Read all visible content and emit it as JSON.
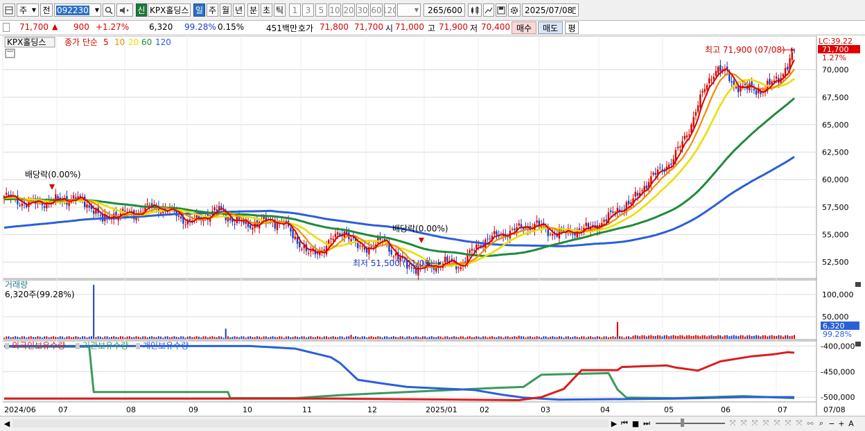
{
  "toolbar": {
    "period": "주",
    "prev": "전",
    "code": "092230",
    "new_badge": "신",
    "stock_name": "KPX홀딩스",
    "tf_day": "일",
    "tf_week": "주",
    "tf_month": "월",
    "tf_year": "년",
    "tf_min": "분",
    "tf_sec": "초",
    "tf_tick": "틱",
    "n1": "1",
    "n3": "3",
    "n5": "5",
    "n10": "10",
    "n20": "20",
    "n30": "30",
    "n60": "60",
    "n120": "120",
    "count": "265",
    "count_total": "/600",
    "date": "2025/07/08"
  },
  "info": {
    "price": "71,700",
    "change_arrow": "▲",
    "change": "900",
    "change_pct": "+1.27%",
    "volume": "6,320",
    "vol_ratio": "99.28%",
    "turnover": "0.15%",
    "amount": "451백만",
    "bid_label": "호가",
    "bid1": "71,800",
    "bid2": "71,700",
    "open_label": "시",
    "open": "71,000",
    "high_label": "고",
    "high": "71,900",
    "low_label": "저",
    "low": "70,400",
    "buy": "매수",
    "sell": "매도",
    "eval": "평"
  },
  "legend": {
    "name": "KPX홀딩스",
    "type": "종가 단순",
    "ma5": "5",
    "ma10": "10",
    "ma20": "20",
    "ma60": "60",
    "ma120": "120"
  },
  "colors": {
    "up": "#d60000",
    "down": "#1a3dbf",
    "ma5": "#d60000",
    "ma10": "#f08c00",
    "ma20": "#e8e000",
    "ma60": "#1e8a3c",
    "ma120": "#2a5fd8",
    "foreign": "#d81e1e",
    "inst": "#3a9a5a",
    "indiv": "#2a5fd8"
  },
  "chart_data": [
    {
      "type": "candlestick",
      "title": "KPX홀딩스",
      "ylim": [
        51000,
        73000
      ],
      "y_ticks": [
        "52,500",
        "55,000",
        "57,500",
        "60,000",
        "62,500",
        "65,000",
        "67,500",
        "70,000"
      ],
      "x_ticks": [
        "2024/06",
        "07",
        "08",
        "09",
        "10",
        "11",
        "12",
        "2025/01",
        "02",
        "03",
        "04",
        "05",
        "06",
        "07",
        "07/08"
      ],
      "close_anchors": [
        [
          0,
          58500
        ],
        [
          10,
          57800
        ],
        [
          20,
          58000
        ],
        [
          32,
          58300
        ],
        [
          40,
          57400
        ],
        [
          44,
          56200
        ],
        [
          48,
          56800
        ],
        [
          58,
          56900
        ],
        [
          66,
          57600
        ],
        [
          76,
          57000
        ],
        [
          82,
          56100
        ],
        [
          88,
          56500
        ],
        [
          96,
          57300
        ],
        [
          102,
          56300
        ],
        [
          110,
          55900
        ],
        [
          118,
          56300
        ],
        [
          125,
          56000
        ],
        [
          130,
          54700
        ],
        [
          136,
          53200
        ],
        [
          142,
          53600
        ],
        [
          148,
          54800
        ],
        [
          152,
          55400
        ],
        [
          158,
          53800
        ],
        [
          164,
          53900
        ],
        [
          170,
          54500
        ],
        [
          174,
          53200
        ],
        [
          180,
          52200
        ],
        [
          186,
          51900
        ],
        [
          192,
          52200
        ],
        [
          198,
          52500
        ],
        [
          204,
          52200
        ],
        [
          208,
          53200
        ],
        [
          212,
          54100
        ],
        [
          216,
          54600
        ],
        [
          222,
          55000
        ],
        [
          228,
          55400
        ],
        [
          232,
          55700
        ],
        [
          238,
          55900
        ],
        [
          244,
          55200
        ],
        [
          250,
          55100
        ],
        [
          254,
          55300
        ],
        [
          258,
          55400
        ],
        [
          262,
          55600
        ],
        [
          268,
          56200
        ],
        [
          274,
          57300
        ],
        [
          280,
          57800
        ],
        [
          284,
          59000
        ],
        [
          290,
          60300
        ],
        [
          294,
          61000
        ],
        [
          298,
          61600
        ],
        [
          302,
          63000
        ],
        [
          306,
          64600
        ],
        [
          310,
          66800
        ],
        [
          314,
          68700
        ],
        [
          318,
          70100
        ],
        [
          322,
          69800
        ],
        [
          326,
          68600
        ],
        [
          332,
          68300
        ],
        [
          338,
          68100
        ],
        [
          342,
          68600
        ],
        [
          346,
          69200
        ],
        [
          350,
          70400
        ],
        [
          353,
          71700
        ]
      ],
      "last_close": 71700,
      "annotations": {
        "max": "최고 71,900 (07/08)",
        "min": "최저 51,500 (01/09)",
        "dividend1": "배당락(0.00%)",
        "dividend2": "배당락(0.00%)"
      },
      "right_axis": {
        "lc_label": "LC:39.22",
        "price": "71,700",
        "pct": "1.27%"
      }
    },
    {
      "type": "bar",
      "title": "거래량",
      "current": "6,320주(99.28%)",
      "ylim": [
        0,
        125000
      ],
      "y_ticks": [
        "50,000",
        "100,000"
      ],
      "spikes": [
        {
          "i": 40,
          "v": 122000
        },
        {
          "i": 99,
          "v": 23000
        },
        {
          "i": 274,
          "v": 38000
        },
        {
          "i": 155,
          "v": 9000
        },
        {
          "i": 230,
          "v": 7000
        }
      ],
      "last_value": "6,320",
      "last_pct": "99.28%"
    },
    {
      "type": "line",
      "series_labels": [
        "외국인보유수량",
        "기관보유수량",
        "개인보유수량"
      ],
      "ylim": [
        -508000,
        -394000
      ],
      "y_ticks": [
        "-400,000",
        "-450,000",
        "-500,000"
      ],
      "foreign": [
        [
          0,
          -503000
        ],
        [
          150,
          -503000
        ],
        [
          230,
          -506000
        ],
        [
          240,
          -500000
        ],
        [
          250,
          -484000
        ],
        [
          258,
          -447000
        ],
        [
          274,
          -447000
        ],
        [
          276,
          -441000
        ],
        [
          296,
          -438000
        ],
        [
          300,
          -442000
        ],
        [
          310,
          -448000
        ],
        [
          320,
          -430000
        ],
        [
          334,
          -420000
        ],
        [
          344,
          -416000
        ],
        [
          350,
          -412000
        ],
        [
          353,
          -413000
        ]
      ],
      "institution": [
        [
          0,
          -401000
        ],
        [
          38,
          -401000
        ],
        [
          40,
          -490000
        ],
        [
          100,
          -490000
        ],
        [
          101,
          -502000
        ],
        [
          130,
          -502000
        ],
        [
          150,
          -496000
        ],
        [
          200,
          -486000
        ],
        [
          220,
          -482000
        ],
        [
          232,
          -480000
        ],
        [
          240,
          -456000
        ],
        [
          270,
          -453000
        ],
        [
          274,
          -485000
        ],
        [
          278,
          -501000
        ],
        [
          300,
          -502000
        ],
        [
          330,
          -498000
        ],
        [
          353,
          -502000
        ]
      ],
      "individual": [
        [
          0,
          -400000
        ],
        [
          110,
          -400000
        ],
        [
          130,
          -405000
        ],
        [
          146,
          -422000
        ],
        [
          150,
          -433000
        ],
        [
          158,
          -466000
        ],
        [
          170,
          -474000
        ],
        [
          180,
          -480000
        ],
        [
          210,
          -486000
        ],
        [
          222,
          -495000
        ],
        [
          232,
          -501000
        ],
        [
          248,
          -505000
        ],
        [
          300,
          -503000
        ],
        [
          330,
          -500000
        ],
        [
          353,
          -500000
        ]
      ]
    }
  ]
}
